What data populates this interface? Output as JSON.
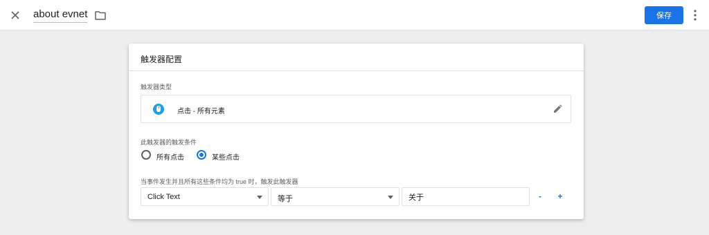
{
  "topbar": {
    "title": "about evnet",
    "save_label": "保存"
  },
  "card": {
    "header": "触发器配置",
    "trigger_type_label": "触发器类型",
    "trigger_type": {
      "icon": "mouse-click-icon",
      "label": "点击 - 所有元素"
    },
    "fires_on_label": "此触发器的触发条件",
    "fires_on_options": [
      {
        "label": "所有点击",
        "checked": false
      },
      {
        "label": "某些点击",
        "checked": true
      }
    ],
    "condition_label": "当事件发生并且所有这些条件均为 true 时，触发此触发器",
    "condition": {
      "variable": "Click Text",
      "operator": "等于",
      "value": "关于"
    },
    "remove_label": "-",
    "add_label": "+"
  },
  "colors": {
    "accent": "#1a73e8",
    "icon_badge": "#1ea0e6",
    "page_background": "#eeeeee"
  }
}
